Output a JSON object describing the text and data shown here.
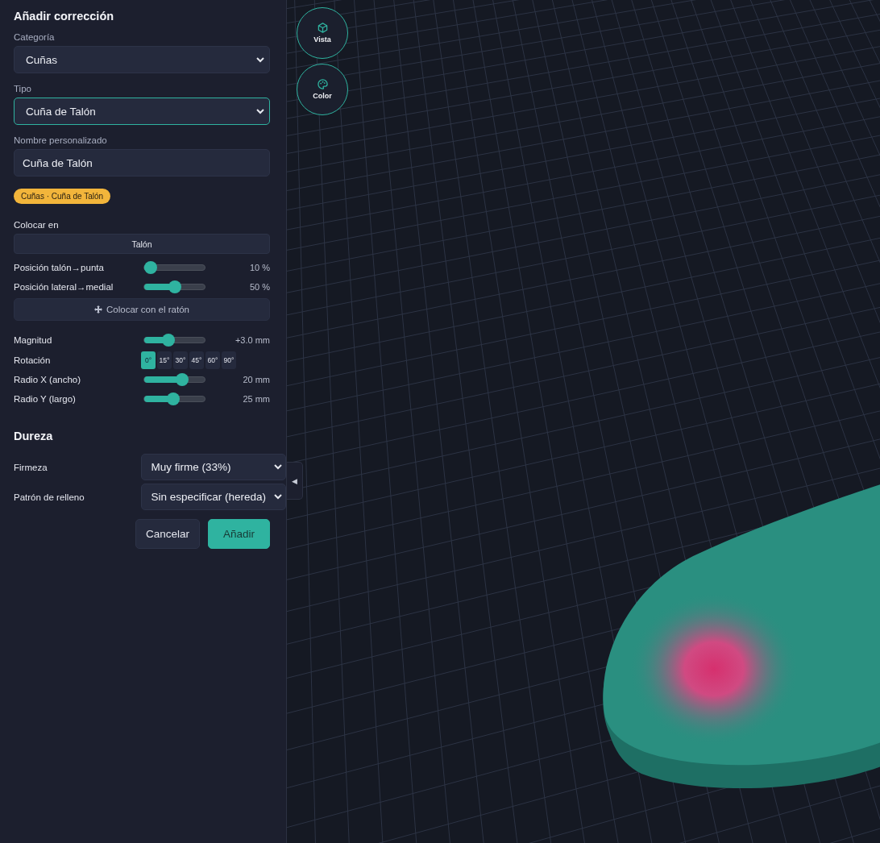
{
  "panel": {
    "title": "Añadir corrección",
    "fields": [
      {
        "kind": "select",
        "label": "Categoría",
        "value": "Cuñas",
        "focused": false
      },
      {
        "kind": "select",
        "label": "Tipo",
        "value": "Cuña de Talón",
        "focused": true
      },
      {
        "kind": "text",
        "label": "Nombre personalizado",
        "value": "Cuña de Talón",
        "focused": false
      }
    ],
    "badge": "Cuñas · Cuña de Talón",
    "placement": {
      "label": "Colocar en",
      "zone": "Talón"
    },
    "position_sliders": [
      {
        "label": "Posición talón→punta",
        "level": 0.1,
        "reading": "10 %"
      },
      {
        "label": "Posición lateral→medial",
        "level": 0.5,
        "reading": "50 %"
      }
    ],
    "mouse_button": "Colocar con el ratón",
    "adjustments": [
      {
        "kind": "slider",
        "label": "Magnitud",
        "level": 0.4,
        "reading": "+3.0 mm"
      },
      {
        "kind": "angles",
        "label": "Rotación",
        "options": [
          {
            "label": "0°",
            "selected": true
          },
          {
            "label": "15°",
            "selected": false
          },
          {
            "label": "30°",
            "selected": false
          },
          {
            "label": "45°",
            "selected": false
          },
          {
            "label": "60°",
            "selected": false
          },
          {
            "label": "90°",
            "selected": false
          }
        ]
      },
      {
        "kind": "slider",
        "label": "Radio X (ancho)",
        "level": 0.63,
        "reading": "20 mm"
      },
      {
        "kind": "slider",
        "label": "Radio Y (largo)",
        "level": 0.48,
        "reading": "25 mm"
      }
    ],
    "hardness": {
      "title": "Dureza",
      "fields": [
        {
          "label": "Firmeza",
          "value": "Muy firme (33%)"
        },
        {
          "label": "Patrón de relleno",
          "value": "Sin especificar (hereda)"
        }
      ]
    },
    "actions": [
      {
        "kind": "secondary",
        "label": "Cancelar"
      },
      {
        "kind": "primary",
        "label": "Añadir"
      }
    ],
    "collapse_toggle": "◀"
  },
  "viewport": {
    "tools": [
      {
        "kind": "cube",
        "label": "Vista"
      },
      {
        "kind": "palette",
        "label": "Color"
      }
    ]
  }
}
